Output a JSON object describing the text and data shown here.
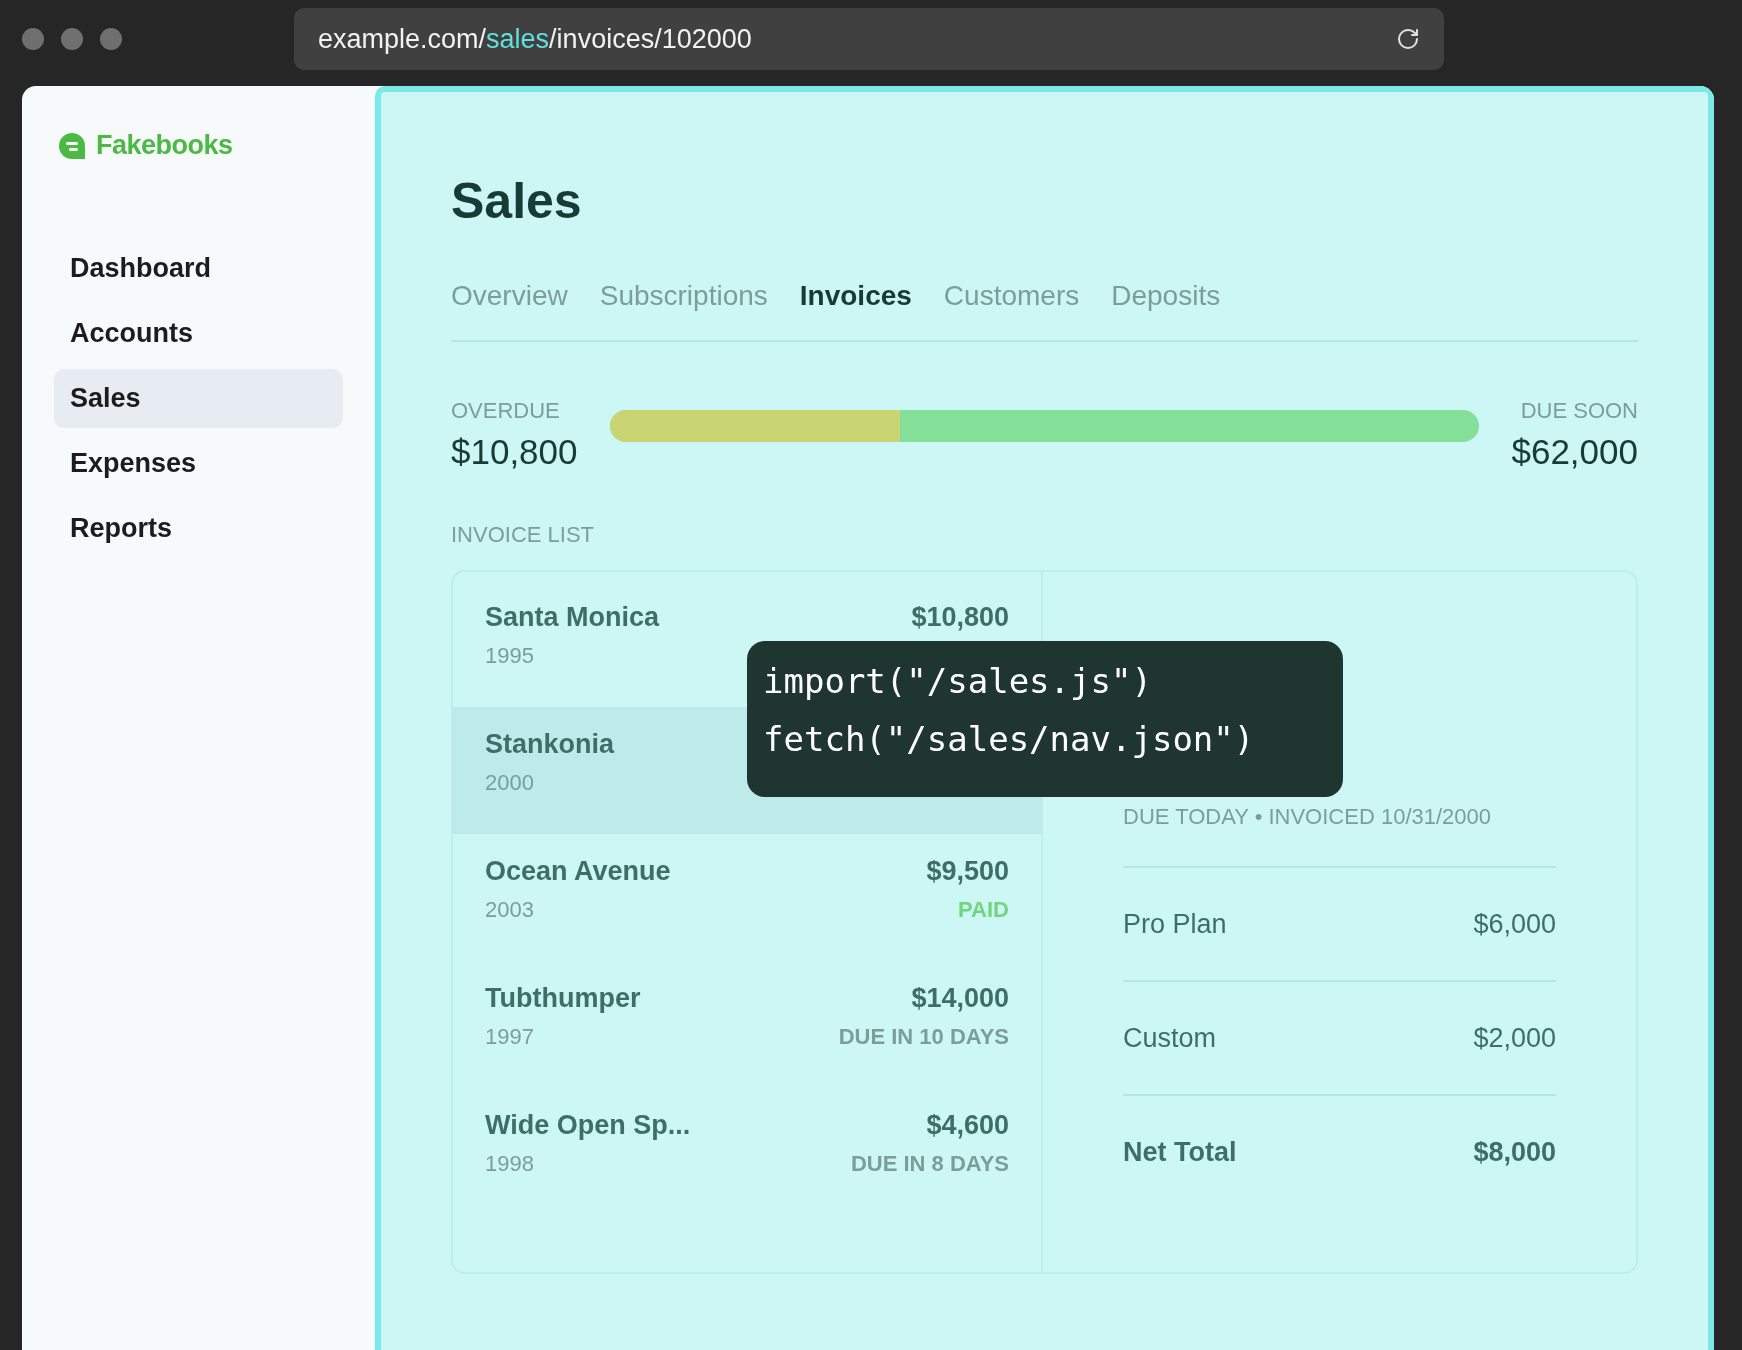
{
  "browser": {
    "url_parts": [
      {
        "text": "example.com/",
        "highlight": false
      },
      {
        "text": "sales",
        "highlight": true
      },
      {
        "text": "/invoices/102000",
        "highlight": false
      }
    ]
  },
  "sidebar": {
    "brand": "Fakebooks",
    "items": [
      {
        "label": "Dashboard",
        "selected": false
      },
      {
        "label": "Accounts",
        "selected": false
      },
      {
        "label": "Sales",
        "selected": true
      },
      {
        "label": "Expenses",
        "selected": false
      },
      {
        "label": "Reports",
        "selected": false
      }
    ]
  },
  "page": {
    "title": "Sales",
    "tabs": [
      {
        "label": "Overview",
        "selected": false
      },
      {
        "label": "Subscriptions",
        "selected": false
      },
      {
        "label": "Invoices",
        "selected": true
      },
      {
        "label": "Customers",
        "selected": false
      },
      {
        "label": "Deposits",
        "selected": false
      }
    ]
  },
  "balance": {
    "overdue_label": "OVERDUE",
    "overdue_amount": "$10,800",
    "due_soon_label": "DUE SOON",
    "due_soon_amount": "$62,000",
    "level": 0.334
  },
  "invoice_list": {
    "heading": "INVOICE LIST",
    "rows": [
      {
        "name": "Santa Monica",
        "year": "1995",
        "amount": "$10,800",
        "selected": false
      },
      {
        "name": "Stankonia",
        "year": "2000",
        "selected": true
      },
      {
        "name": "Ocean Avenue",
        "year": "2003",
        "amount": "$9,500",
        "status": "PAID",
        "kind": "paid",
        "selected": false
      },
      {
        "name": "Tubthumper",
        "year": "1997",
        "amount": "$14,000",
        "status": "DUE IN 10 DAYS",
        "kind": "due",
        "selected": false
      },
      {
        "name": "Wide Open Sp...",
        "year": "1998",
        "amount": "$4,600",
        "status": "DUE IN 8 DAYS",
        "kind": "due",
        "selected": false
      }
    ]
  },
  "invoice_detail": {
    "meta": "DUE TODAY • INVOICED 10/31/2000",
    "lines": [
      {
        "label": "Pro Plan",
        "amount": "$6,000",
        "kind": "item"
      },
      {
        "label": "Custom",
        "amount": "$2,000",
        "kind": "item"
      },
      {
        "label": "Net Total",
        "amount": "$8,000",
        "kind": "total"
      }
    ]
  },
  "code_overlay": {
    "lines": [
      "import(\"/sales.js\")",
      "fetch(\"/sales/nav.json\")"
    ]
  }
}
